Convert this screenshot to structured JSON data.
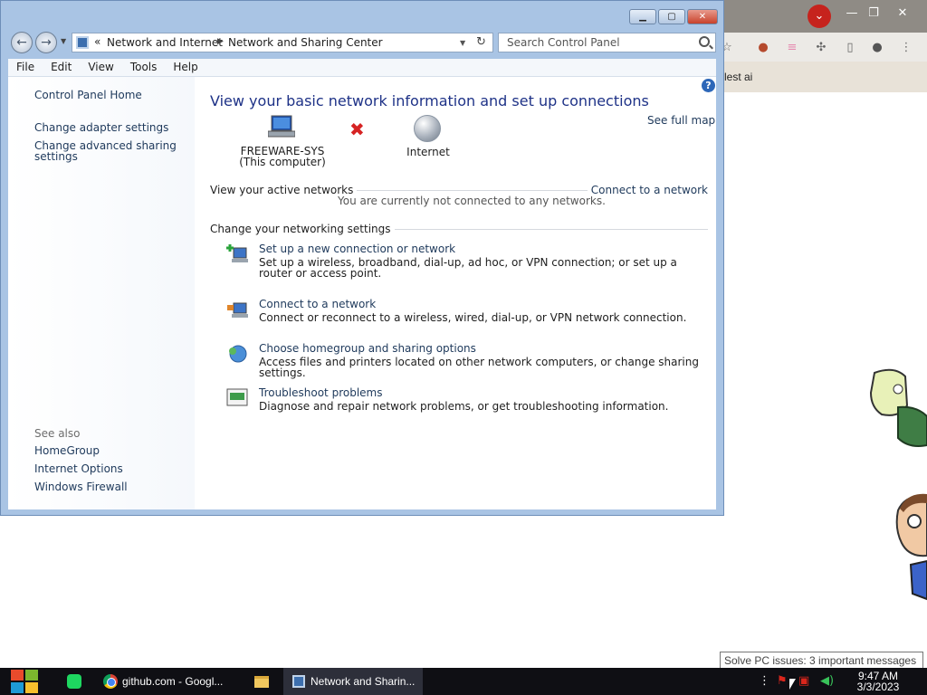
{
  "window": {
    "nav": {
      "chevrons": "«",
      "crumbs": [
        "Network and Internet",
        "Network and Sharing Center"
      ]
    },
    "search": {
      "placeholder": "Search Control Panel"
    },
    "menu": [
      "File",
      "Edit",
      "View",
      "Tools",
      "Help"
    ]
  },
  "left_pane": {
    "home": "Control Panel Home",
    "change_adapter": "Change adapter settings",
    "change_sharing": "Change advanced sharing settings",
    "see_also": "See also",
    "homegroup": "HomeGroup",
    "internet_options": "Internet Options",
    "windows_firewall": "Windows Firewall"
  },
  "main": {
    "title": "View your basic network information and set up connections",
    "see_full_map": "See full map",
    "computer_name": "FREEWARE-SYS",
    "computer_sub": "(This computer)",
    "internet_label": "Internet",
    "active_networks": "View your active networks",
    "connect_link": "Connect to a network",
    "not_connected": "You are currently not connected to any networks.",
    "change_settings": "Change your networking settings",
    "tasks": [
      {
        "title": "Set up a new connection or network",
        "desc": "Set up a wireless, broadband, dial-up, ad hoc, or VPN connection; or set up a router or access point."
      },
      {
        "title": "Connect to a network",
        "desc": "Connect or reconnect to a wireless, wired, dial-up, or VPN network connection."
      },
      {
        "title": "Choose homegroup and sharing options",
        "desc": "Access files and printers located on other network computers, or change sharing settings."
      },
      {
        "title": "Troubleshoot problems",
        "desc": "Diagnose and repair network problems, or get troubleshooting information."
      }
    ]
  },
  "chrome_bg": {
    "bookmark_text": "lest ai"
  },
  "notification": "Solve PC issues: 3 important messages",
  "taskbar": {
    "chrome_label": "github.com - Googl...",
    "network_label": "Network and Sharin...",
    "time": "9:47 AM",
    "date": "3/3/2023"
  }
}
